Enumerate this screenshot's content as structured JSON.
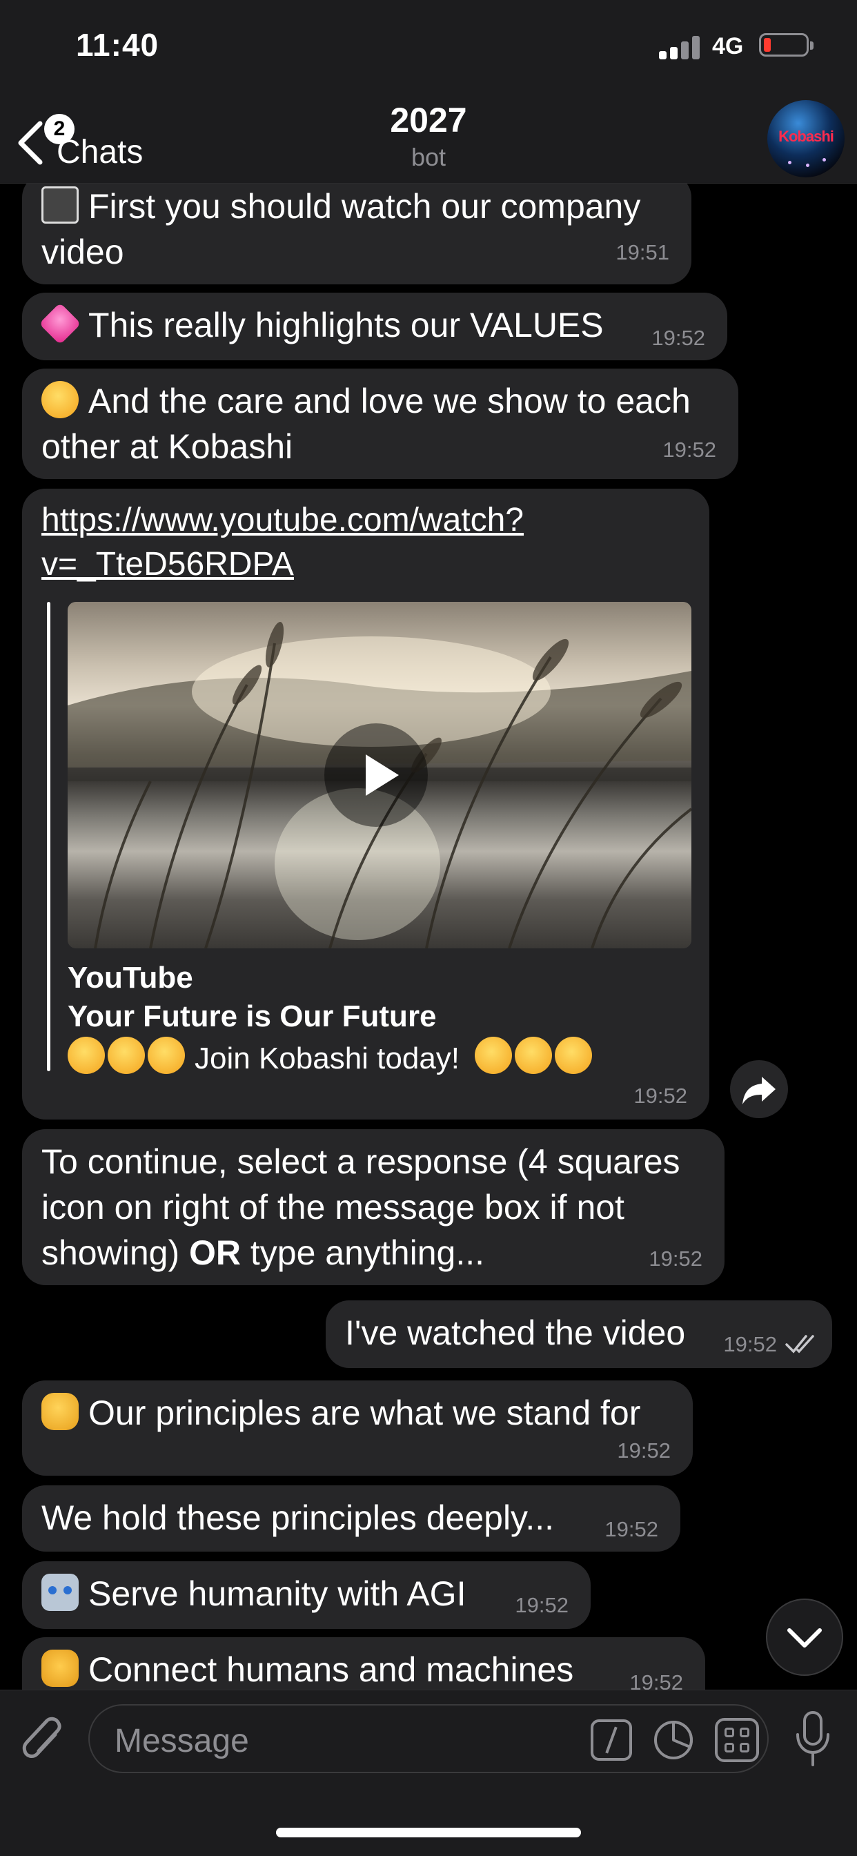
{
  "status": {
    "time": "11:40",
    "network": "4G"
  },
  "nav": {
    "back_label": "Chats",
    "unread_badge": "2",
    "title": "2027",
    "subtitle": "bot",
    "avatar_text": "Kobashi"
  },
  "messages": [
    {
      "text": "First you should watch our company video",
      "time": "19:51",
      "emoji": "clapper-board"
    },
    {
      "text": "This really highlights our VALUES",
      "time": "19:52",
      "emoji": "sparkling-heart"
    },
    {
      "text": "And the care and love we show to each other at Kobashi",
      "time": "19:52",
      "emoji": "hugging-face"
    },
    {
      "link": "https://www.youtube.com/watch?v=_TteD56RDPA",
      "link_line1": "https://www.youtube.com/watch?",
      "link_line2": "v=_TteD56RDPA",
      "preview_site": "YouTube",
      "preview_title": "Your Future is Our Future",
      "preview_desc": "Join Kobashi today!",
      "time": "19:52"
    },
    {
      "text_before": "To continue, select a response (4 squares icon on right of the message box if not showing) ",
      "text_bold": "OR",
      "text_after": " type anything...",
      "time": "19:52"
    },
    {
      "text": "I've watched the video",
      "time": "19:52",
      "outgoing": true,
      "status": "read"
    },
    {
      "text": "Our principles are what we stand for",
      "time": "19:52",
      "emoji": "raised-fist"
    },
    {
      "text": "We hold these principles deeply...",
      "time": "19:52"
    },
    {
      "text": "Serve humanity with AGI",
      "time": "19:52",
      "emoji": "robot"
    },
    {
      "text": "Connect humans and machines",
      "time": "19:52",
      "emoji": "handshake"
    }
  ],
  "composer": {
    "placeholder": "Message"
  },
  "colors": {
    "bubble": "#262628",
    "bar": "#1c1c1e",
    "background": "#000000",
    "timestamp": "#8d8d92"
  }
}
